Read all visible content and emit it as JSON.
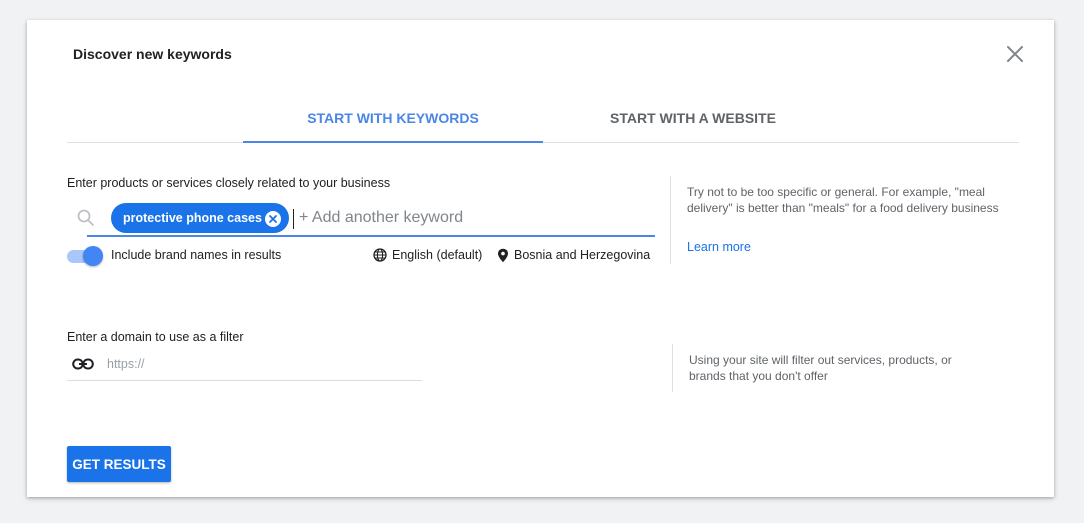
{
  "dialog": {
    "title": "Discover new keywords",
    "close_icon": "close-icon"
  },
  "tabs": [
    {
      "label": "START WITH KEYWORDS",
      "active": true
    },
    {
      "label": "START WITH A WEBSITE",
      "active": false
    }
  ],
  "keywords_section": {
    "label": "Enter products or services closely related to your business",
    "search_icon": "search-icon",
    "chips": [
      {
        "label": "protective phone cases",
        "remove_icon": "close-circle-icon"
      }
    ],
    "input_placeholder": "+ Add another keyword",
    "brand_toggle": {
      "label": "Include brand names in results",
      "on": true
    },
    "language": {
      "icon": "globe-icon",
      "label": "English (default)"
    },
    "location": {
      "icon": "location-pin-icon",
      "label": "Bosnia and Herzegovina"
    },
    "hint": "Try not to be too specific or general. For example, \"meal delivery\" is better than \"meals\" for a food delivery business",
    "learn_more": "Learn more"
  },
  "domain_section": {
    "label": "Enter a domain to use as a filter",
    "link_icon": "link-icon",
    "input_placeholder": "https://",
    "hint": "Using your site will filter out services, products, or brands that you don't offer"
  },
  "actions": {
    "get_results": "GET RESULTS"
  },
  "colors": {
    "accent": "#1a73e8",
    "tab_active": "#4a86e8",
    "toggle_track": "#a8c7fa",
    "toggle_thumb": "#4285f4"
  }
}
